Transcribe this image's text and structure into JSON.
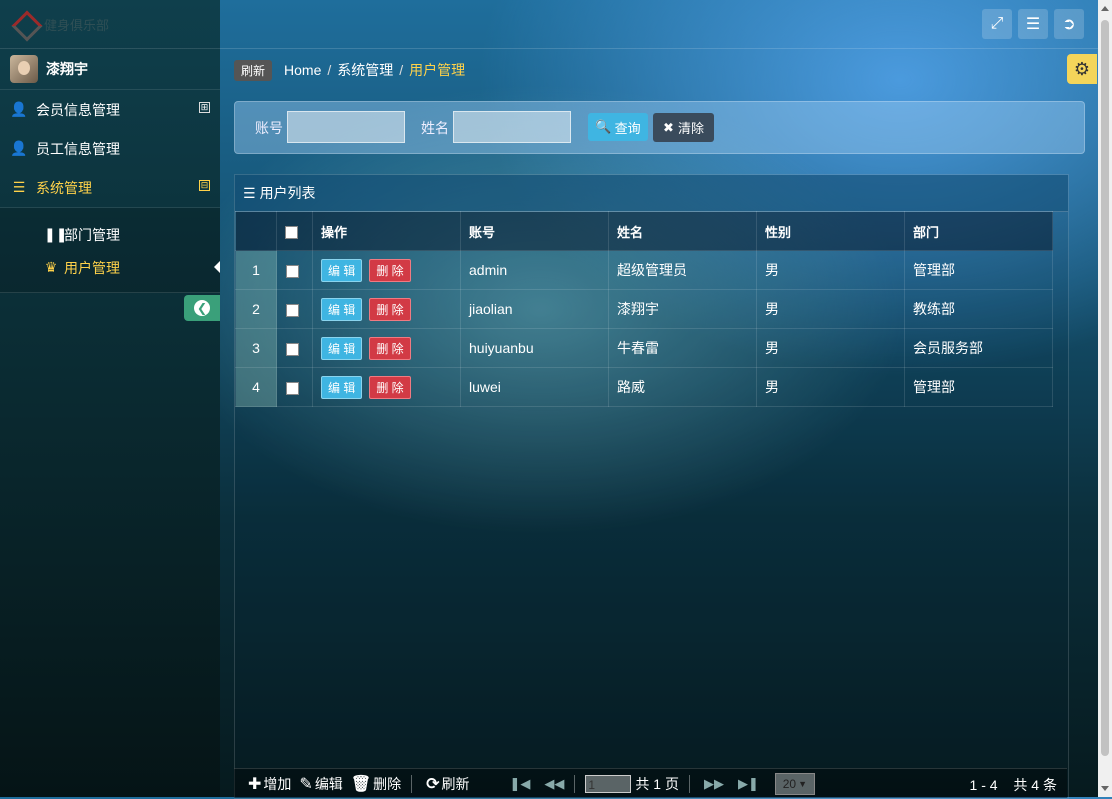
{
  "sidebar": {
    "logo_text": "健身俱乐部",
    "user_name": "漆翔宇",
    "menu": [
      {
        "label": "会员信息管理",
        "icon": "user-icon",
        "toggle": "⊞"
      },
      {
        "label": "员工信息管理",
        "icon": "user-icon",
        "toggle": ""
      },
      {
        "label": "系统管理",
        "icon": "list-icon",
        "toggle": "⊟"
      }
    ],
    "submenu": [
      {
        "label": "部门管理",
        "icon": "pause-icon"
      },
      {
        "label": "用户管理",
        "icon": "crown-icon"
      }
    ]
  },
  "breadcrumb": {
    "refresh_label": "刷新",
    "home": "Home",
    "parent": "系统管理",
    "current": "用户管理",
    "sep": "/"
  },
  "search": {
    "account_label": "账号",
    "name_label": "姓名",
    "query_label": "查询",
    "clear_label": "清除"
  },
  "grid": {
    "title": "用户列表",
    "columns": [
      "操作",
      "账号",
      "姓名",
      "性别",
      "部门"
    ],
    "edit_label": "编 辑",
    "delete_label": "删 除",
    "rows": [
      {
        "num": "1",
        "account": "admin",
        "name": "超级管理员",
        "gender": "男",
        "dept": "管理部"
      },
      {
        "num": "2",
        "account": "jiaolian",
        "name": "漆翔宇",
        "gender": "男",
        "dept": "教练部"
      },
      {
        "num": "3",
        "account": "huiyuanbu",
        "name": "牛春雷",
        "gender": "男",
        "dept": "会员服务部"
      },
      {
        "num": "4",
        "account": "luwei",
        "name": "路威",
        "gender": "男",
        "dept": "管理部"
      }
    ]
  },
  "pager": {
    "add_label": "增加",
    "edit_label": "编辑",
    "delete_label": "删除",
    "refresh_label": "刷新",
    "page_value": "1",
    "total_pages": "共 1 页",
    "page_size": "20",
    "range": "1 - 4",
    "total": "共 4 条"
  },
  "colors": {
    "accent": "#ffd24a",
    "query": "#3fb5e2",
    "delete": "#d23a45"
  }
}
